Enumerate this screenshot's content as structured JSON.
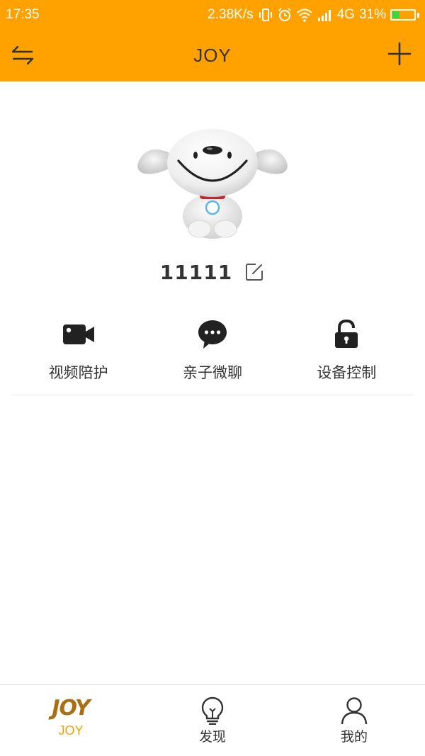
{
  "status_bar": {
    "time": "17:35",
    "net_speed": "2.38K/s",
    "network": "4G",
    "battery": "31%",
    "battery_level": 0.31
  },
  "app_bar": {
    "title": "JOY",
    "left_icon": "switch-arrows-icon",
    "right_icon": "plus-icon"
  },
  "device": {
    "name": "11111",
    "avatar": "joy-robot-dog",
    "edit_icon": "edit-icon"
  },
  "features": [
    {
      "label": "视频陪护",
      "icon": "video-camera-icon"
    },
    {
      "label": "亲子微聊",
      "icon": "chat-bubble-icon"
    },
    {
      "label": "设备控制",
      "icon": "lock-icon"
    }
  ],
  "tabs": [
    {
      "logo": "JOY",
      "label": "JOY",
      "active": true
    },
    {
      "label": "发现",
      "icon": "lightbulb-icon"
    },
    {
      "label": "我的",
      "icon": "person-icon"
    }
  ],
  "colors": {
    "brand": "#ffa200",
    "active_tab": "#f0a300",
    "logo": "#a96f12",
    "battery": "#3ed63e"
  }
}
